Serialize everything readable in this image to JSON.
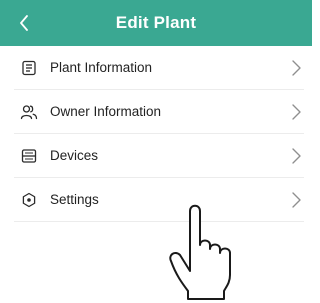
{
  "header": {
    "title": "Edit Plant",
    "back_icon": "chevron-left-icon",
    "background": "#3aa892"
  },
  "menu": {
    "items": [
      {
        "label": "Plant Information",
        "icon": "document-icon"
      },
      {
        "label": "Owner Information",
        "icon": "users-icon"
      },
      {
        "label": "Devices",
        "icon": "device-icon"
      },
      {
        "label": "Settings",
        "icon": "settings-icon"
      }
    ],
    "chevron_icon": "chevron-right-icon"
  },
  "overlay": {
    "icon": "tap-hand-icon"
  }
}
